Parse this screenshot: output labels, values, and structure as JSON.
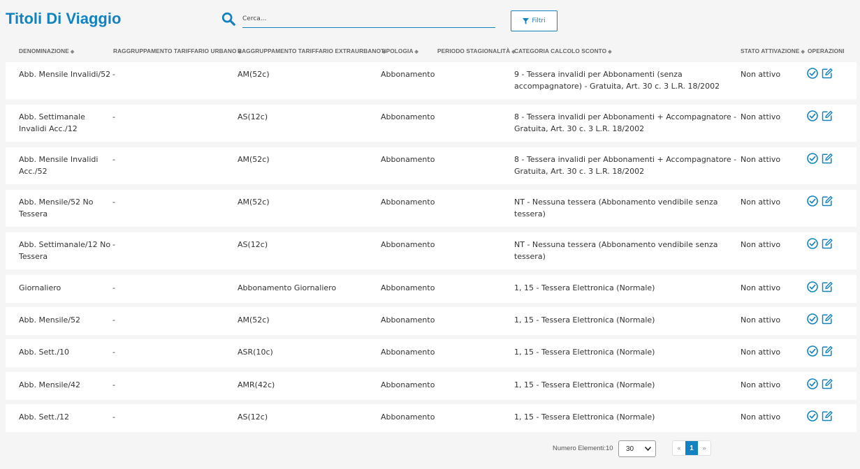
{
  "header": {
    "title": "Titoli Di Viaggio",
    "search_placeholder": "Cerca...",
    "filter_label": "Filtri",
    "search_icon": "search-icon",
    "filter_icon": "funnel-icon"
  },
  "columns": [
    {
      "label": "DENOMINAZIONE",
      "sortable": true
    },
    {
      "label": "RAGGRUPPAMENTO TARIFFARIO URBANO",
      "sortable": true
    },
    {
      "label": "RAGGRUPPAMENTO TARIFFARIO EXTRAURBANO",
      "sortable": true
    },
    {
      "label": "TIPOLOGIA",
      "sortable": true
    },
    {
      "label": "PERIODO STAGIONALITÀ",
      "sortable": true
    },
    {
      "label": "CATEGORIA CALCOLO SCONTO",
      "sortable": true
    },
    {
      "label": "STATO ATTIVAZIONE",
      "sortable": true
    },
    {
      "label": "OPERAZIONI",
      "sortable": false
    }
  ],
  "rows": [
    {
      "denominazione": "Abb. Mensile Invalidi/52",
      "urbano": "-",
      "extraurbano": "AM(52c)",
      "tipologia": "Abbonamento",
      "categoria": "9 - Tessera invalidi per Abbonamenti (senza accompagnatore) - Gratuita, Art. 30 c. 3 L.R. 18/2002",
      "stato": "Non attivo"
    },
    {
      "denominazione": "Abb. Settimanale Invalidi Acc./12",
      "urbano": "-",
      "extraurbano": "AS(12c)",
      "tipologia": "Abbonamento",
      "categoria": "8 - Tessera invalidi per Abbonamenti + Accompagnatore - Gratuita, Art. 30 c. 3 L.R. 18/2002",
      "stato": "Non attivo"
    },
    {
      "denominazione": "Abb. Mensile Invalidi Acc./52",
      "urbano": "-",
      "extraurbano": "AM(52c)",
      "tipologia": "Abbonamento",
      "categoria": "8 - Tessera invalidi per Abbonamenti + Accompagnatore - Gratuita, Art. 30 c. 3 L.R. 18/2002",
      "stato": "Non attivo"
    },
    {
      "denominazione": "Abb. Mensile/52 No Tessera",
      "urbano": "-",
      "extraurbano": "AM(52c)",
      "tipologia": "Abbonamento",
      "categoria": "NT - Nessuna tessera (Abbonamento vendibile senza tessera)",
      "stato": "Non attivo"
    },
    {
      "denominazione": "Abb. Settimanale/12 No Tessera",
      "urbano": "-",
      "extraurbano": "AS(12c)",
      "tipologia": "Abbonamento",
      "categoria": "NT - Nessuna tessera (Abbonamento vendibile senza tessera)",
      "stato": "Non attivo"
    },
    {
      "denominazione": "Giornaliero",
      "urbano": "-",
      "extraurbano": "Abbonamento Giornaliero",
      "tipologia": "Abbonamento",
      "categoria": "1, 15 - Tessera Elettronica (Normale)",
      "stato": "Non attivo"
    },
    {
      "denominazione": "Abb. Mensile/52",
      "urbano": "-",
      "extraurbano": "AM(52c)",
      "tipologia": "Abbonamento",
      "categoria": "1, 15 - Tessera Elettronica (Normale)",
      "stato": "Non attivo"
    },
    {
      "denominazione": "Abb. Sett./10",
      "urbano": "-",
      "extraurbano": "ASR(10c)",
      "tipologia": "Abbonamento",
      "categoria": "1, 15 - Tessera Elettronica (Normale)",
      "stato": "Non attivo"
    },
    {
      "denominazione": "Abb. Mensile/42",
      "urbano": "-",
      "extraurbano": "AMR(42c)",
      "tipologia": "Abbonamento",
      "categoria": "1, 15 - Tessera Elettronica (Normale)",
      "stato": "Non attivo"
    },
    {
      "denominazione": "Abb. Sett./12",
      "urbano": "-",
      "extraurbano": "AS(12c)",
      "tipologia": "Abbonamento",
      "categoria": "1, 15 - Tessera Elettronica (Normale)",
      "stato": "Non attivo"
    }
  ],
  "row_operations": [
    "activate-check-icon",
    "edit-icon"
  ],
  "footer": {
    "count_label": "Numero Elementi:10",
    "page_size": "30",
    "pager": {
      "prev": "«",
      "current": "1",
      "next": "»"
    }
  },
  "colors": {
    "accent": "#1282c0",
    "background": "#f5f5f5",
    "row_background": "#ffffff"
  }
}
